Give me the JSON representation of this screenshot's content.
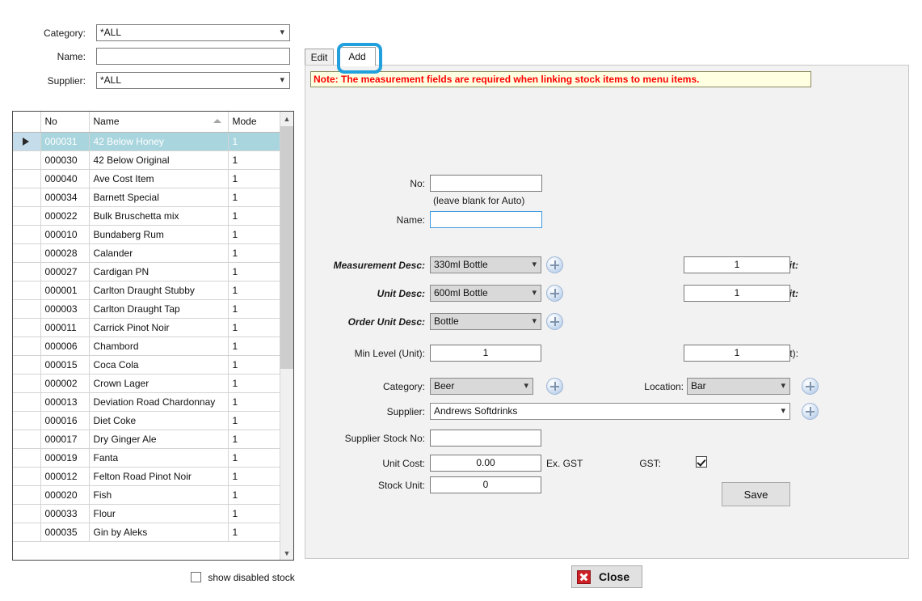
{
  "filters": {
    "category": {
      "label": "Category:",
      "value": "*ALL"
    },
    "name": {
      "label": "Name:",
      "value": "",
      "placeholder": ""
    },
    "supplier": {
      "label": "Supplier:",
      "value": "*ALL"
    }
  },
  "grid": {
    "columns": [
      "",
      "No",
      "Name",
      "Mode"
    ],
    "sort_column": "Name",
    "sort_direction": "ascending",
    "rows": [
      {
        "no": "000031",
        "name": "42 Below Honey",
        "mode": "1",
        "selected": true
      },
      {
        "no": "000030",
        "name": "42 Below Original",
        "mode": "1",
        "selected": false
      },
      {
        "no": "000040",
        "name": "Ave Cost Item",
        "mode": "1",
        "selected": false
      },
      {
        "no": "000034",
        "name": "Barnett Special",
        "mode": "1",
        "selected": false
      },
      {
        "no": "000022",
        "name": "Bulk Bruschetta mix",
        "mode": "1",
        "selected": false
      },
      {
        "no": "000010",
        "name": "Bundaberg Rum",
        "mode": "1",
        "selected": false
      },
      {
        "no": "000028",
        "name": "Calander",
        "mode": "1",
        "selected": false
      },
      {
        "no": "000027",
        "name": "Cardigan PN",
        "mode": "1",
        "selected": false
      },
      {
        "no": "000001",
        "name": "Carlton Draught Stubby",
        "mode": "1",
        "selected": false
      },
      {
        "no": "000003",
        "name": "Carlton Draught Tap",
        "mode": "1",
        "selected": false
      },
      {
        "no": "000011",
        "name": "Carrick Pinot Noir",
        "mode": "1",
        "selected": false
      },
      {
        "no": "000006",
        "name": "Chambord",
        "mode": "1",
        "selected": false
      },
      {
        "no": "000015",
        "name": "Coca Cola",
        "mode": "1",
        "selected": false
      },
      {
        "no": "000002",
        "name": "Crown Lager",
        "mode": "1",
        "selected": false
      },
      {
        "no": "000013",
        "name": "Deviation Road Chardonnay",
        "mode": "1",
        "selected": false
      },
      {
        "no": "000016",
        "name": "Diet Coke",
        "mode": "1",
        "selected": false
      },
      {
        "no": "000017",
        "name": "Dry Ginger Ale",
        "mode": "1",
        "selected": false
      },
      {
        "no": "000019",
        "name": "Fanta",
        "mode": "1",
        "selected": false
      },
      {
        "no": "000012",
        "name": "Felton Road Pinot Noir",
        "mode": "1",
        "selected": false
      },
      {
        "no": "000020",
        "name": "Fish",
        "mode": "1",
        "selected": false
      },
      {
        "no": "000033",
        "name": "Flour",
        "mode": "1",
        "selected": false
      },
      {
        "no": "000035",
        "name": "Gin by Aleks",
        "mode": "1",
        "selected": false
      }
    ]
  },
  "show_disabled": {
    "label": "show disabled stock",
    "checked": false
  },
  "tabs": [
    {
      "label": "Edit",
      "active": false
    },
    {
      "label": "Add",
      "active": true
    }
  ],
  "note": "Note: The measurement fields are required when linking stock items to menu items.",
  "form": {
    "no": {
      "label": "No:",
      "value": ""
    },
    "no_hint": "(leave blank for Auto)",
    "name": {
      "label": "Name:",
      "value": ""
    },
    "measurement_desc": {
      "label": "Measurement Desc:",
      "value": "330ml Bottle"
    },
    "measurement_per_unit": {
      "label": "Measurement/Unit:",
      "value": "1"
    },
    "unit_desc": {
      "label": "Unit Desc:",
      "value": "600ml Bottle"
    },
    "unit_per_order_unit": {
      "label": "Unit / Order Unit:",
      "value": "1"
    },
    "order_unit_desc": {
      "label": "Order Unit Desc:",
      "value": "Bottle"
    },
    "min_level": {
      "label": "Min Level (Unit):",
      "value": "1"
    },
    "par_level": {
      "label": "par Level (Unit):",
      "value": "1"
    },
    "category": {
      "label": "Category:",
      "value": "Beer"
    },
    "location": {
      "label": "Location:",
      "value": "Bar"
    },
    "supplier": {
      "label": "Supplier:",
      "value": "Andrews Softdrinks"
    },
    "supplier_stock_no": {
      "label": "Supplier Stock No:",
      "value": ""
    },
    "unit_cost": {
      "label": "Unit Cost:",
      "value": "0.00"
    },
    "ex_gst": "Ex. GST",
    "gst": {
      "label": "GST:",
      "checked": true
    },
    "stock_unit": {
      "label": "Stock Unit:",
      "value": "0"
    }
  },
  "buttons": {
    "save": "Save",
    "close": "Close"
  },
  "colors": {
    "selection": "#a9d5de",
    "note_text": "#ff0000",
    "note_background": "#ffffe1",
    "highlight_ring": "#22a0dd",
    "close_icon": "#cc2026"
  }
}
